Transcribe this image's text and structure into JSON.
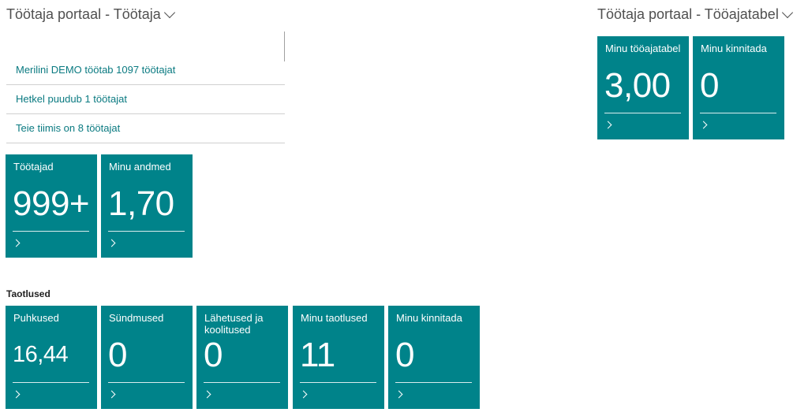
{
  "left_section": {
    "title": "Töötaja portaal - Töötaja"
  },
  "right_section": {
    "title": "Töötaja portaal - Tööajatabel"
  },
  "info_links": [
    "Merilini DEMO töötab 1097 töötajat",
    "Hetkel puudub 1 töötajat",
    "Teie tiimis on 8 töötajat"
  ],
  "main_tiles": [
    {
      "label": "Töötajad",
      "value": "999+"
    },
    {
      "label": "Minu andmed",
      "value": "1,70"
    }
  ],
  "timesheet_tiles": [
    {
      "label": "Minu tööajatabel",
      "value": "3,00"
    },
    {
      "label": "Minu kinnitada",
      "value": "0"
    }
  ],
  "requests": {
    "label": "Taotlused",
    "tiles": [
      {
        "label": "Puhkused",
        "value": "16,44"
      },
      {
        "label": "Sündmused",
        "value": "0"
      },
      {
        "label": "Lähetused ja koolitused",
        "value": "0"
      },
      {
        "label": "Minu taotlused",
        "value": "11"
      },
      {
        "label": "Minu kinnitada",
        "value": "0"
      }
    ]
  },
  "colors": {
    "tile": "#00838a",
    "link": "#0a7a81"
  },
  "icons": {
    "dropdown": "chevron-down-icon",
    "tile_drilldown": "chevron-right-icon"
  }
}
